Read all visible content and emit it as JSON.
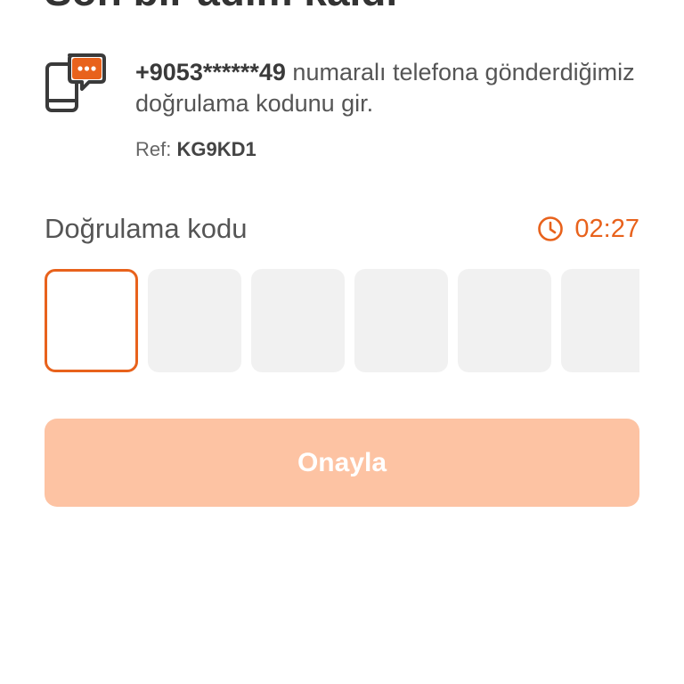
{
  "page": {
    "title": "Son bir adım kaldı"
  },
  "info": {
    "icon": "phone-chat-icon",
    "phone": "+9053******49",
    "message": " numaralı telefona gönderdiğimiz doğrulama kodunu gir.",
    "ref_label": "Ref: ",
    "ref_code": "KG9KD1"
  },
  "code": {
    "label": "Doğrulama kodu",
    "timer_icon": "clock-icon",
    "timer": "02:27",
    "digits": [
      "",
      "",
      "",
      "",
      "",
      ""
    ],
    "active_index": 0
  },
  "actions": {
    "confirm_label": "Onayla"
  },
  "colors": {
    "accent": "#e8621c",
    "button_disabled": "#fdc3a3",
    "box_empty": "#f1f1f1"
  }
}
